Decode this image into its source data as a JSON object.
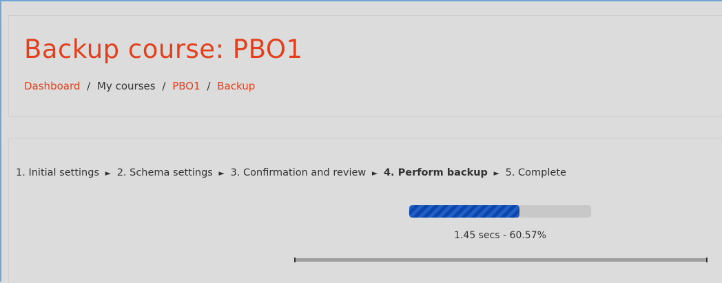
{
  "page": {
    "title": "Backup course: PBO1"
  },
  "breadcrumb": {
    "items": [
      {
        "label": "Dashboard",
        "link": true
      },
      {
        "label": "My courses",
        "link": false
      },
      {
        "label": "PBO1",
        "link": true
      },
      {
        "label": "Backup",
        "link": true
      }
    ],
    "separator": "/"
  },
  "steps": {
    "items": [
      {
        "label": "1. Initial settings",
        "current": false
      },
      {
        "label": "2. Schema settings",
        "current": false
      },
      {
        "label": "3. Confirmation and review",
        "current": false
      },
      {
        "label": "4. Perform backup",
        "current": true
      },
      {
        "label": "5. Complete",
        "current": false
      }
    ],
    "arrow": "►"
  },
  "progress": {
    "percent": 60.57,
    "status_text": "1.45 secs - 60.57%"
  },
  "colors": {
    "accent": "#e2401c",
    "progress_fill": "#1f5fc8",
    "background": "#dcdcdc"
  }
}
